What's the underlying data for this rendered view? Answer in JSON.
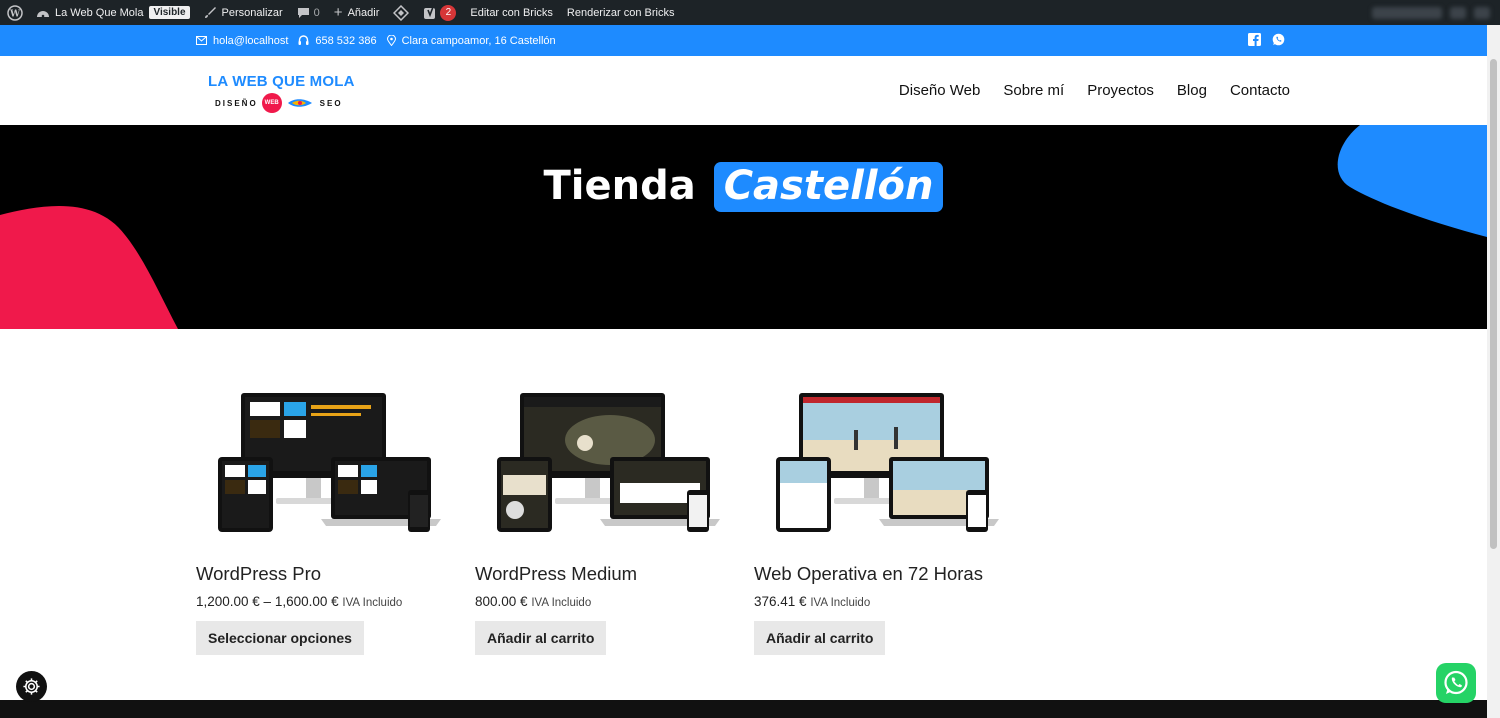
{
  "admin_bar": {
    "site_name": "La Web Que Mola",
    "visibility": "Visible",
    "customize": "Personalizar",
    "comments_count": "0",
    "add_new": "Añadir",
    "yoast_count": "2",
    "edit_bricks": "Editar con Bricks",
    "render_bricks": "Renderizar con Bricks"
  },
  "topbar": {
    "email": "hola@localhost",
    "phone": "658 532 386",
    "address": "Clara campoamor, 16 Castellón"
  },
  "header": {
    "logo_line1": "LA WEB QUE MOLA",
    "logo_left": "DISEÑO",
    "logo_center": "WEB",
    "logo_right": "SEO",
    "nav": [
      "Diseño Web",
      "Sobre mí",
      "Proyectos",
      "Blog",
      "Contacto"
    ]
  },
  "hero": {
    "title_plain": "Tienda",
    "title_highlight": "Castellón"
  },
  "products": [
    {
      "name": "WordPress Pro",
      "price": "1,200.00 € – 1,600.00 €",
      "tax_note": "IVA Incluido",
      "button": "Seleccionar opciones"
    },
    {
      "name": "WordPress Medium",
      "price": "800.00 €",
      "tax_note": "IVA Incluido",
      "button": "Añadir al carrito"
    },
    {
      "name": "Web Operativa en 72 Horas",
      "price": "376.41 €",
      "tax_note": "IVA Incluido",
      "button": "Añadir al carrito"
    }
  ],
  "colors": {
    "brand_blue": "#1e8bff",
    "accent_pink": "#f0194b",
    "admin_bar": "#1d2327",
    "button_bg": "#e8e8e8"
  },
  "icons": {
    "email": "mail-icon",
    "phone": "headset-icon",
    "address": "map-pin-icon",
    "facebook": "facebook-icon",
    "whatsapp": "whatsapp-icon",
    "cookie": "gear-icon"
  }
}
